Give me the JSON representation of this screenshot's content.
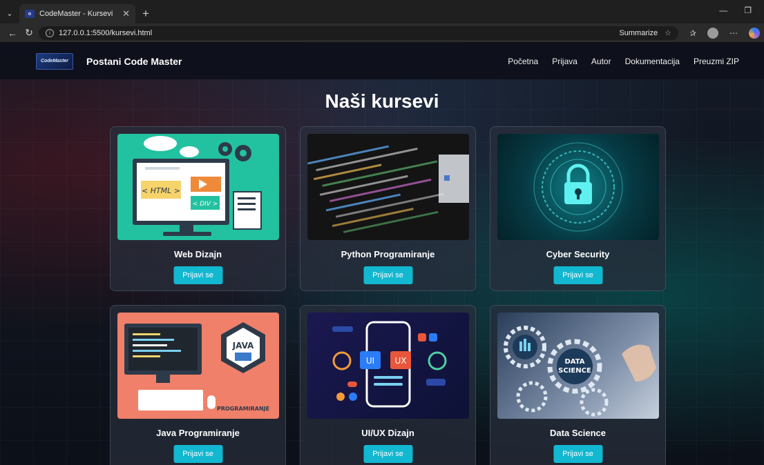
{
  "browser": {
    "tab_title": "CodeMaster - Kursevi",
    "url": "127.0.0.1:5500/kursevi.html",
    "summarize_label": "Summarize"
  },
  "nav": {
    "brand": "Postani Code Master",
    "logo_text": "CodeMaster",
    "links": [
      "Početna",
      "Prijava",
      "Autor",
      "Dokumentacija",
      "Preuzmi ZIP"
    ]
  },
  "main": {
    "title": "Naši kursevi",
    "courses": [
      {
        "name": "Web Dizajn",
        "button": "Prijavi se"
      },
      {
        "name": "Python Programiranje",
        "button": "Prijavi se"
      },
      {
        "name": "Cyber Security",
        "button": "Prijavi se"
      },
      {
        "name": "Java Programiranje",
        "button": "Prijavi se"
      },
      {
        "name": "UI/UX Dizajn",
        "button": "Prijavi se"
      },
      {
        "name": "Data Science",
        "button": "Prijavi se"
      }
    ],
    "thumb_text": {
      "html_tag": "< HTML >",
      "div_tag": "< DIV >",
      "java": "JAVA",
      "programiranje": "PROGRAMIRANJE",
      "ui": "UI",
      "ux": "UX",
      "data_science_line1": "DATA",
      "data_science_line2": "SCIENCE"
    }
  },
  "colors": {
    "accent_button": "#12b7d0",
    "nav_bg": "#0e101a"
  }
}
